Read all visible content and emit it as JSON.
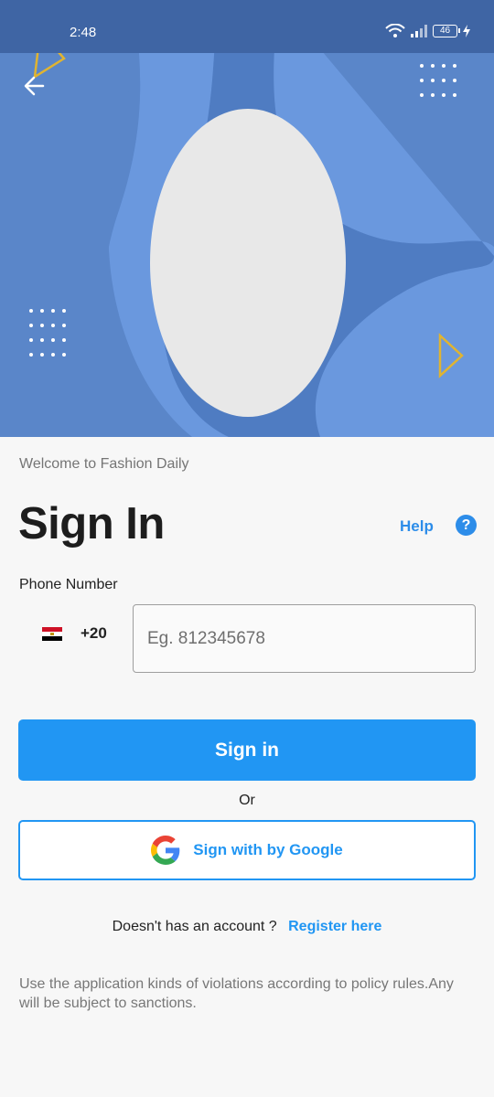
{
  "status_bar": {
    "time": "2:48",
    "battery": "46"
  },
  "header": {
    "back_icon": "arrow-left-icon"
  },
  "auth": {
    "welcome": "Welcome to Fashion Daily",
    "title": "Sign In",
    "help_label": "Help",
    "help_icon": "?",
    "phone_label": "Phone Number",
    "country_code": "+20",
    "phone_placeholder": "Eg. 812345678",
    "signin_label": "Sign in",
    "or_label": "Or",
    "google_label": "Sign with by Google",
    "no_account": "Doesn't has an account ?",
    "register_label": "Register here",
    "policy_text": "Use the application kinds of violations according to policy rules.Any will be subject to sanctions."
  },
  "colors": {
    "primary": "#2196f3",
    "header_bg": "#5a86c9",
    "status_bar": "#3f65a4",
    "accent_triangle": "#e0b431"
  }
}
